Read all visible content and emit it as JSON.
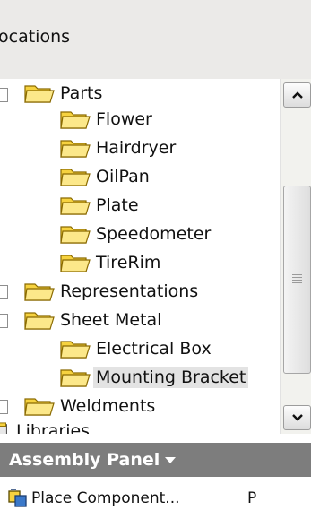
{
  "header": {
    "title": "ocations"
  },
  "tree": {
    "items": [
      {
        "label": "Parts",
        "level": 0,
        "expanded": true
      },
      {
        "label": "Flower",
        "level": 1
      },
      {
        "label": "Hairdryer",
        "level": 1
      },
      {
        "label": "OilPan",
        "level": 1
      },
      {
        "label": "Plate",
        "level": 1
      },
      {
        "label": "Speedometer",
        "level": 1
      },
      {
        "label": "TireRim",
        "level": 1
      },
      {
        "label": "Representations",
        "level": 0
      },
      {
        "label": "Sheet Metal",
        "level": 0,
        "expanded": true
      },
      {
        "label": "Electrical Box",
        "level": 1
      },
      {
        "label": "Mounting Bracket",
        "level": 1,
        "selected": true
      },
      {
        "label": "Weldments",
        "level": 0
      },
      {
        "label": "Libraries",
        "level": 0
      }
    ]
  },
  "panel": {
    "title": "Assembly Panel"
  },
  "commands": [
    {
      "label": "Place Component...",
      "shortcut": "P"
    }
  ],
  "colors": {
    "folder_fill": "#f6d23f",
    "folder_tab": "#fce88a",
    "folder_outline": "#8a6a00",
    "panel_header_bg": "#7d7d7d"
  },
  "icons": {
    "folder": "folder-icon",
    "scroll_up": "chevron-up-icon",
    "scroll_down": "chevron-down-icon",
    "command": "place-component-icon"
  }
}
